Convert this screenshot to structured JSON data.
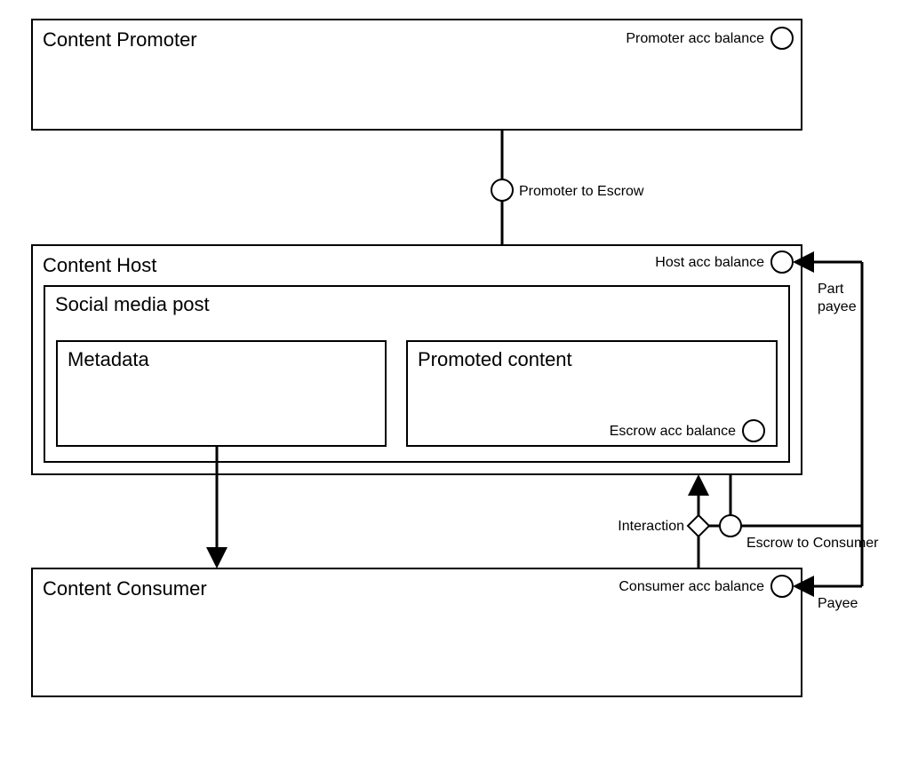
{
  "boxes": {
    "promoter": "Content Promoter",
    "host": "Content Host",
    "post": "Social media post",
    "metadata": "Metadata",
    "promoted": "Promoted content",
    "consumer": "Content Consumer"
  },
  "labels": {
    "promoter_balance": "Promoter acc balance",
    "promoter_to_escrow": "Promoter to Escrow",
    "host_balance": "Host acc balance",
    "part_payee": "Part",
    "part_payee2": "payee",
    "escrow_balance": "Escrow acc balance",
    "interaction": "Interaction",
    "escrow_to_consumer": "Escrow to Consumer",
    "consumer_balance": "Consumer acc balance",
    "payee": "Payee"
  }
}
